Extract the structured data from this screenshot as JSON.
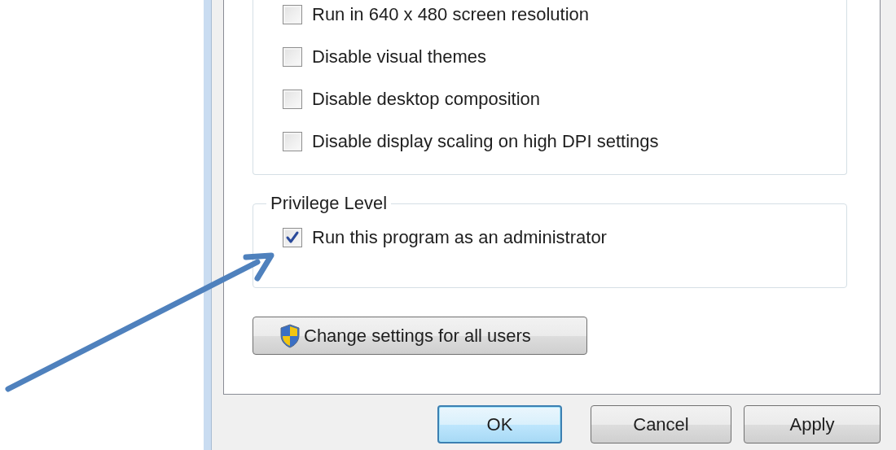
{
  "compatibility_settings": {
    "checkboxes": [
      {
        "label": "Run in 640 x 480 screen resolution",
        "checked": false
      },
      {
        "label": "Disable visual themes",
        "checked": false
      },
      {
        "label": "Disable desktop composition",
        "checked": false
      },
      {
        "label": "Disable display scaling on high DPI settings",
        "checked": false
      }
    ]
  },
  "privilege_level": {
    "title": "Privilege Level",
    "checkboxes": [
      {
        "label": "Run this program as an administrator",
        "checked": true
      }
    ]
  },
  "change_settings_button": {
    "label": "Change settings for all users"
  },
  "buttons": [
    {
      "label": "OK",
      "default": true
    },
    {
      "label": "Cancel",
      "default": false
    },
    {
      "label": "Apply",
      "default": false
    }
  ]
}
